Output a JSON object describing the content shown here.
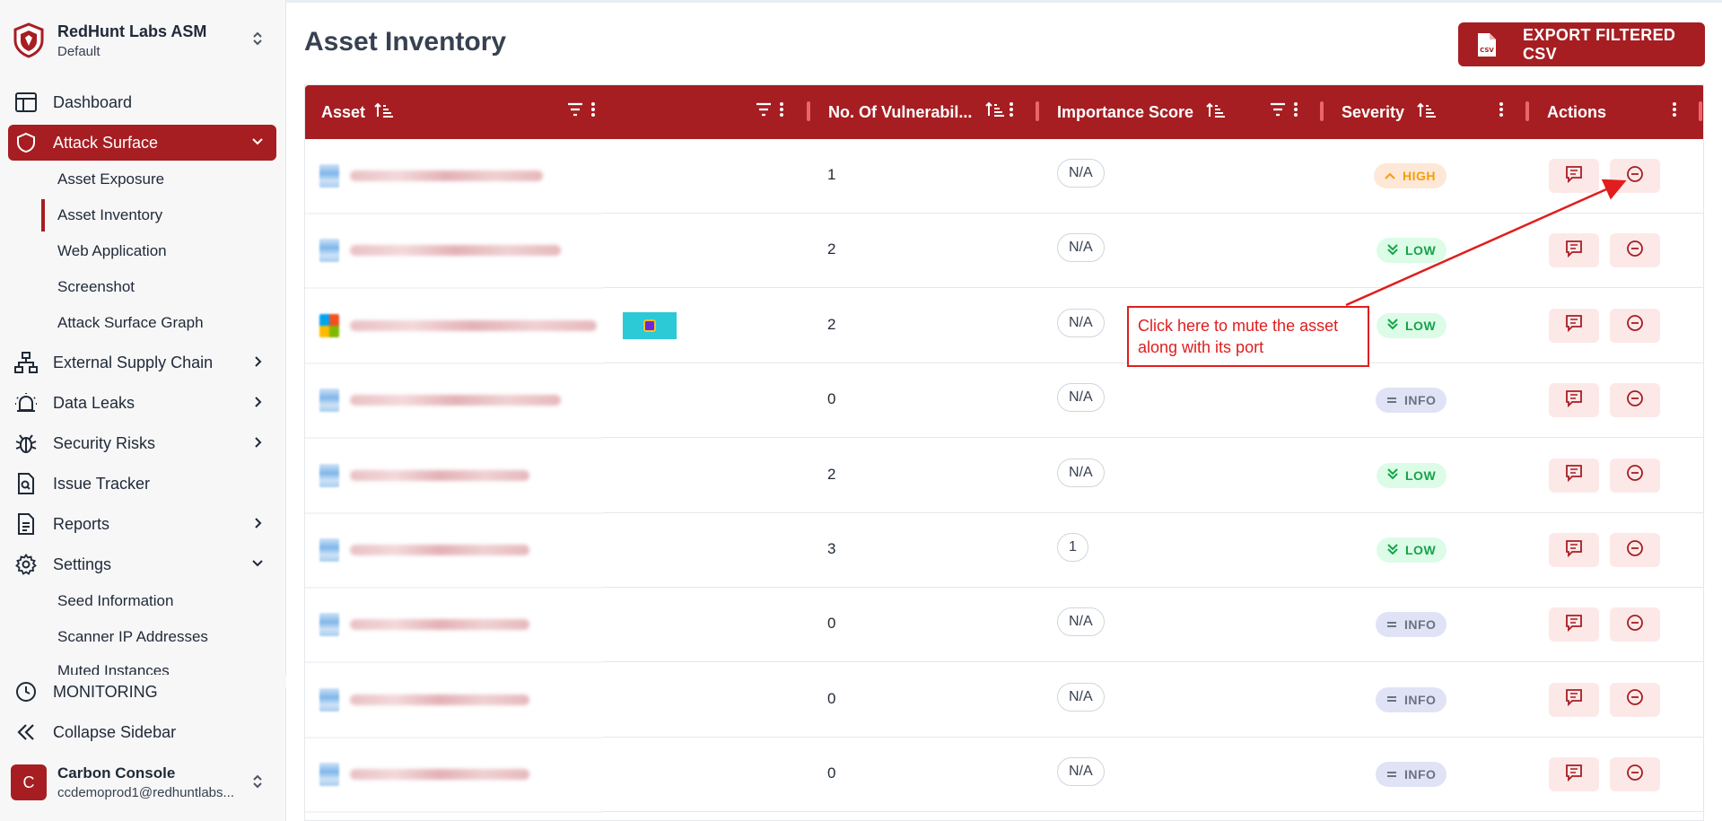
{
  "app": {
    "org_name": "RedHunt Labs ASM",
    "org_workspace": "Default"
  },
  "sidebar": {
    "items": [
      {
        "label": "Dashboard"
      },
      {
        "label": "Attack Surface"
      },
      {
        "label": "External Supply Chain"
      },
      {
        "label": "Data Leaks"
      },
      {
        "label": "Security Risks"
      },
      {
        "label": "Issue Tracker"
      },
      {
        "label": "Reports"
      },
      {
        "label": "Settings"
      },
      {
        "label": "MONITORING"
      },
      {
        "label": "Collapse Sidebar"
      }
    ],
    "attack_surface_sub": [
      "Asset Exposure",
      "Asset Inventory",
      "Web Application",
      "Screenshot",
      "Attack Surface Graph"
    ],
    "settings_sub": [
      "Seed Information",
      "Scanner IP Addresses",
      "Muted Instances"
    ],
    "active_sub": "Asset Inventory"
  },
  "user": {
    "initial": "C",
    "name": "Carbon Console",
    "email": "ccdemoprod1@redhuntlabs..."
  },
  "page": {
    "title": "Asset Inventory",
    "export_label": "EXPORT FILTERED CSV",
    "export_icon_text": "CSV"
  },
  "table": {
    "columns": [
      "Asset",
      "No. Of Vulnerabil...",
      "Importance Score",
      "Severity",
      "Actions"
    ],
    "rows": [
      {
        "vulns": "1",
        "score": "N/A",
        "severity": "HIGH",
        "sev_type": "high"
      },
      {
        "vulns": "2",
        "score": "N/A",
        "severity": "LOW",
        "sev_type": "low"
      },
      {
        "vulns": "2",
        "score": "N/A",
        "severity": "LOW",
        "sev_type": "low"
      },
      {
        "vulns": "0",
        "score": "N/A",
        "severity": "INFO",
        "sev_type": "info"
      },
      {
        "vulns": "2",
        "score": "N/A",
        "severity": "LOW",
        "sev_type": "low"
      },
      {
        "vulns": "3",
        "score": "1",
        "severity": "LOW",
        "sev_type": "low"
      },
      {
        "vulns": "0",
        "score": "N/A",
        "severity": "INFO",
        "sev_type": "info"
      },
      {
        "vulns": "0",
        "score": "N/A",
        "severity": "INFO",
        "sev_type": "info"
      },
      {
        "vulns": "0",
        "score": "N/A",
        "severity": "INFO",
        "sev_type": "info"
      }
    ]
  },
  "annotation": {
    "line1": "Click here to mute the asset",
    "line2": "along with its port"
  },
  "colors": {
    "brand": "#a61e22",
    "annotation": "#e11d1d"
  }
}
